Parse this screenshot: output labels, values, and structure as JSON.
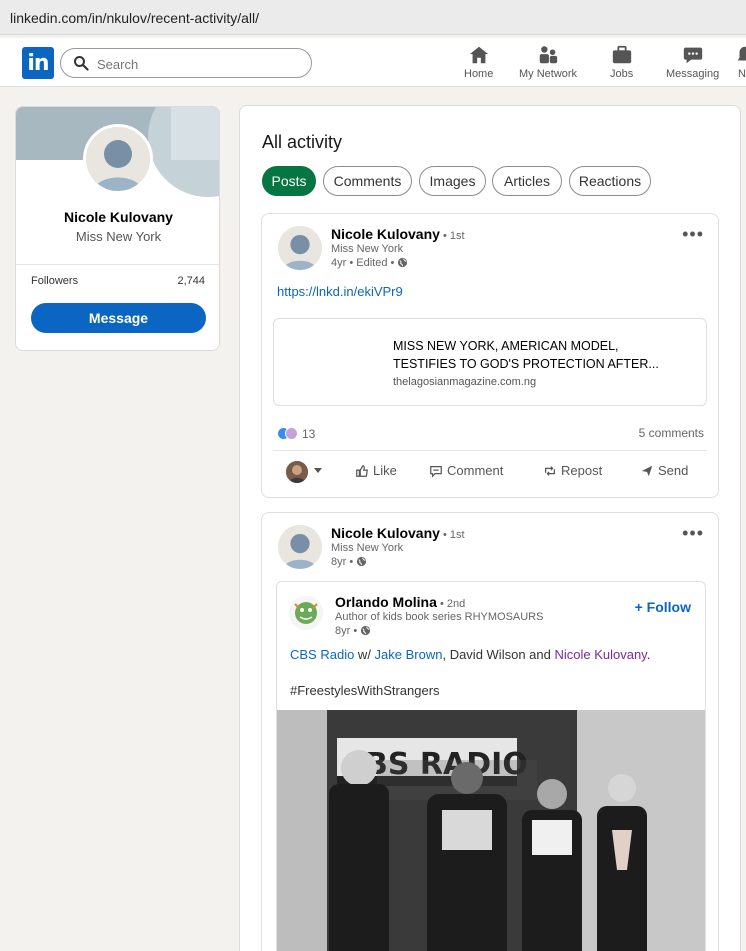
{
  "browser": {
    "url": "linkedin.com/in/nkulov/recent-activity/all/"
  },
  "nav": {
    "search_placeholder": "Search",
    "items": [
      {
        "label": "Home",
        "icon": "home-icon"
      },
      {
        "label": "My Network",
        "icon": "network-icon"
      },
      {
        "label": "Jobs",
        "icon": "briefcase-icon"
      },
      {
        "label": "Messaging",
        "icon": "messaging-icon"
      },
      {
        "label": "No",
        "icon": "bell-icon"
      }
    ]
  },
  "profile_card": {
    "name": "Nicole Kulovany",
    "headline": "Miss New York",
    "followers_label": "Followers",
    "followers_value": "2,744",
    "message_label": "Message"
  },
  "activity": {
    "title": "All activity",
    "filters": [
      "Posts",
      "Comments",
      "Images",
      "Articles",
      "Reactions"
    ],
    "active_filter": "Posts"
  },
  "posts": [
    {
      "author": "Nicole Kulovany",
      "degree": " • 1st",
      "headline": "Miss New York",
      "time": "4yr • Edited • ",
      "link": "https://lnkd.in/ekiVPr9",
      "article_title": "MISS NEW YORK, AMERICAN MODEL, TESTIFIES TO GOD'S PROTECTION AFTER...",
      "article_source": "thelagosianmagazine.com.ng",
      "reaction_count": "13",
      "comments": "5 comments",
      "actions": {
        "like": "Like",
        "comment": "Comment",
        "repost": "Repost",
        "send": "Send"
      }
    },
    {
      "author": "Nicole Kulovany",
      "degree": " • 1st",
      "headline": "Miss New York",
      "time": "8yr • ",
      "shared": {
        "author": "Orlando Molina",
        "degree": " • 2nd",
        "headline": "Author of kids book series RHYMOSAURS",
        "time": "8yr • ",
        "follow": "+ Follow",
        "text_start": "CBS Radio",
        "text_w": " w/ ",
        "mention1": "Jake Brown",
        "text_mid": ", David Wilson and ",
        "mention2": "Nicole Kulovany",
        "text_end": ".",
        "hashtag": "#FreestylesWithStrangers",
        "photo_sign": "CBS RADIO"
      }
    }
  ],
  "colors": {
    "brand": "#0a66c2",
    "active_pill": "#057642",
    "page_bg": "#f3f2ef"
  }
}
